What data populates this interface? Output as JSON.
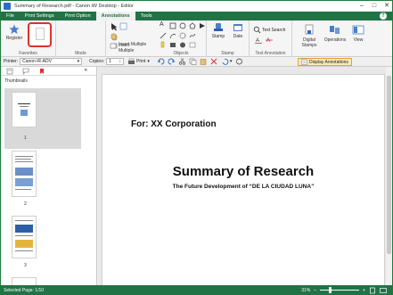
{
  "window": {
    "title": "Summary of Research.pdf - Canon iW Desktop - Editor"
  },
  "menu": {
    "tabs": [
      "File",
      "Print Settings",
      "Print Option",
      "Annotations",
      "Tools"
    ],
    "active": "Annotations"
  },
  "ribbon": {
    "register_label": "Register",
    "favorites_label": "Favorites",
    "mode_label": "Mode",
    "insert_multiple_label": "Insert Multiple",
    "objects_label": "Objects",
    "stamp_label": "Stamp",
    "stamp_group_label": "Stamp",
    "date_label": "Date",
    "text_search_label": "Text Search",
    "text_annotation_label": "Text Annotation",
    "digital_stamps_label": "Digital Stamps",
    "operations_label": "Operations",
    "view_label": "View"
  },
  "toolbar": {
    "printer_label": "Printer:",
    "printer_value": "Canon iR-ADV",
    "copies_label": "Copies:",
    "copies_value": "1",
    "print_label": "Print",
    "display_annotations_label": "Display Annotations"
  },
  "leftpane": {
    "title": "Thumbnails",
    "pages": [
      "1",
      "2",
      "3"
    ]
  },
  "document": {
    "for_line": "For: XX Corporation",
    "title": "Summary of Research",
    "subtitle": "The Future Development of “DE LA CIUDAD LUNA”"
  },
  "status": {
    "selected_page": "Selected Page: 1/10",
    "zoom": "31%"
  },
  "colors": {
    "accent": "#217346",
    "highlight": "#e0302a"
  }
}
